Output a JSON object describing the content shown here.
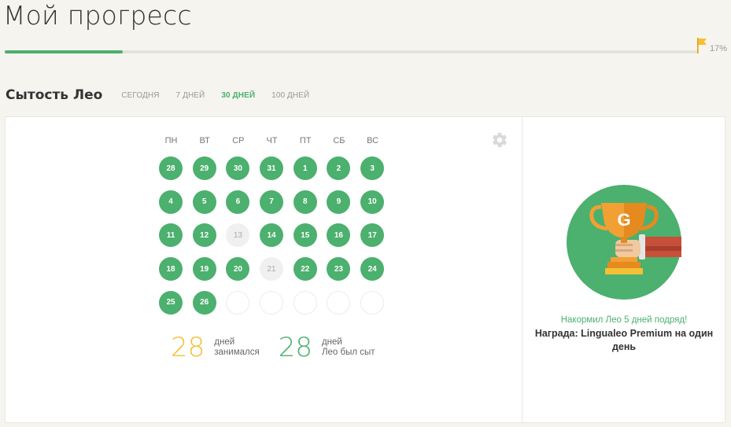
{
  "header": {
    "title": "Мой прогресс",
    "progress_percent": 17,
    "progress_label": "17%"
  },
  "section": {
    "title": "Сытость Лео",
    "tabs": [
      {
        "label": "СЕГОДНЯ",
        "active": false
      },
      {
        "label": "7 ДНЕЙ",
        "active": false
      },
      {
        "label": "30 ДНЕЙ",
        "active": true
      },
      {
        "label": "100 ДНЕЙ",
        "active": false
      }
    ]
  },
  "calendar": {
    "weekdays": [
      "ПН",
      "ВТ",
      "СР",
      "ЧТ",
      "ПТ",
      "СБ",
      "ВС"
    ],
    "days": [
      {
        "label": "28",
        "state": "fed"
      },
      {
        "label": "29",
        "state": "fed"
      },
      {
        "label": "30",
        "state": "fed"
      },
      {
        "label": "31",
        "state": "fed"
      },
      {
        "label": "1",
        "state": "fed"
      },
      {
        "label": "2",
        "state": "fed"
      },
      {
        "label": "3",
        "state": "fed"
      },
      {
        "label": "4",
        "state": "fed"
      },
      {
        "label": "5",
        "state": "fed"
      },
      {
        "label": "6",
        "state": "fed"
      },
      {
        "label": "7",
        "state": "fed"
      },
      {
        "label": "8",
        "state": "fed"
      },
      {
        "label": "9",
        "state": "fed"
      },
      {
        "label": "10",
        "state": "fed"
      },
      {
        "label": "11",
        "state": "fed"
      },
      {
        "label": "12",
        "state": "fed"
      },
      {
        "label": "13",
        "state": "missed"
      },
      {
        "label": "14",
        "state": "fed"
      },
      {
        "label": "15",
        "state": "fed"
      },
      {
        "label": "16",
        "state": "fed"
      },
      {
        "label": "17",
        "state": "fed"
      },
      {
        "label": "18",
        "state": "fed"
      },
      {
        "label": "19",
        "state": "fed"
      },
      {
        "label": "20",
        "state": "fed"
      },
      {
        "label": "21",
        "state": "missed"
      },
      {
        "label": "22",
        "state": "fed"
      },
      {
        "label": "23",
        "state": "fed"
      },
      {
        "label": "24",
        "state": "fed"
      },
      {
        "label": "25",
        "state": "fed"
      },
      {
        "label": "26",
        "state": "fed"
      },
      {
        "label": "",
        "state": "future"
      },
      {
        "label": "",
        "state": "future"
      },
      {
        "label": "",
        "state": "future"
      },
      {
        "label": "",
        "state": "future"
      },
      {
        "label": "",
        "state": "future"
      }
    ]
  },
  "stats": {
    "studied": {
      "value": "28",
      "label_line1": "дней",
      "label_line2": "занимался"
    },
    "fed": {
      "value": "28",
      "label_line1": "дней",
      "label_line2": "Лео был сыт"
    }
  },
  "reward": {
    "streak": "Накормил Лео 5 дней подряд!",
    "prize": "Награда: Lingualeo Premium на один день",
    "trophy_letter": "G"
  },
  "colors": {
    "accent_green": "#4cb06e",
    "accent_yellow": "#f5c035",
    "missed_gray": "#f0f0f0"
  }
}
